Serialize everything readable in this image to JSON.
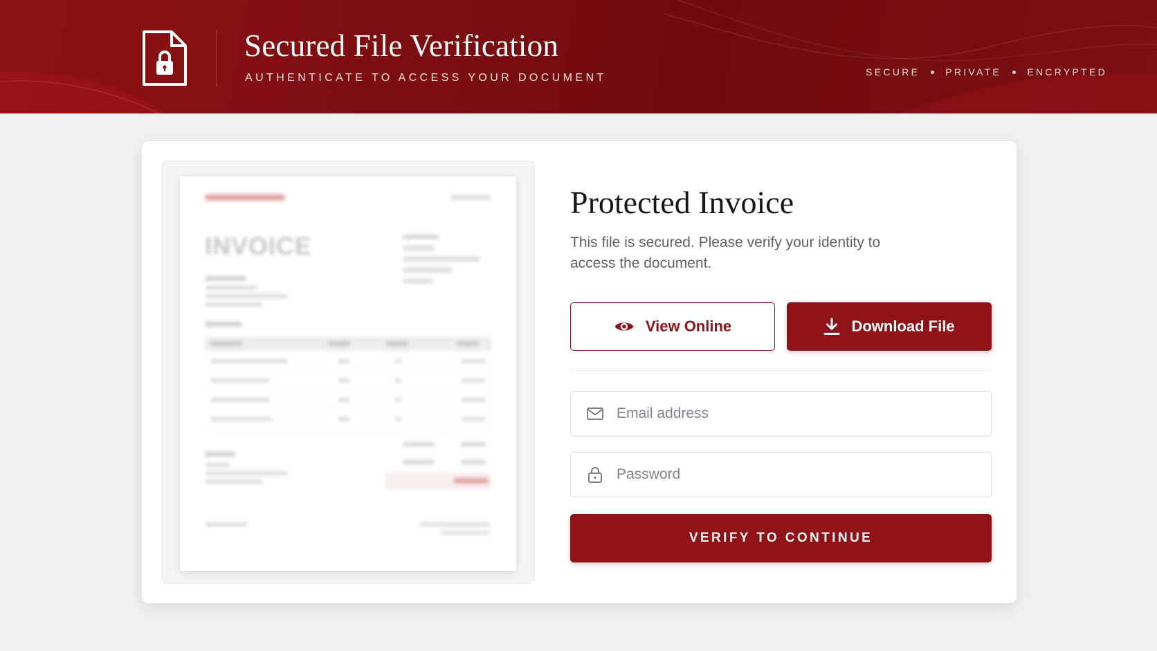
{
  "header": {
    "title": "Secured File Verification",
    "subtitle": "AUTHENTICATE TO ACCESS YOUR DOCUMENT",
    "tags": [
      "SECURE",
      "PRIVATE",
      "ENCRYPTED"
    ]
  },
  "preview": {
    "watermark_word": "INVOICE"
  },
  "main": {
    "title": "Protected Invoice",
    "description": "This file is secured. Please verify your identity to access the document.",
    "view_label": "View Online",
    "download_label": "Download File",
    "email_placeholder": "Email address",
    "password_placeholder": "Password",
    "verify_label": "VERIFY TO CONTINUE"
  },
  "icons": {
    "brand": "file-lock-icon",
    "view": "eye-icon",
    "download": "download-icon",
    "email": "mail-icon",
    "password": "lock-icon"
  },
  "colors": {
    "brand_red": "#8f1316",
    "header_dark": "#6f0b0d",
    "page_bg": "#eeeff1"
  }
}
